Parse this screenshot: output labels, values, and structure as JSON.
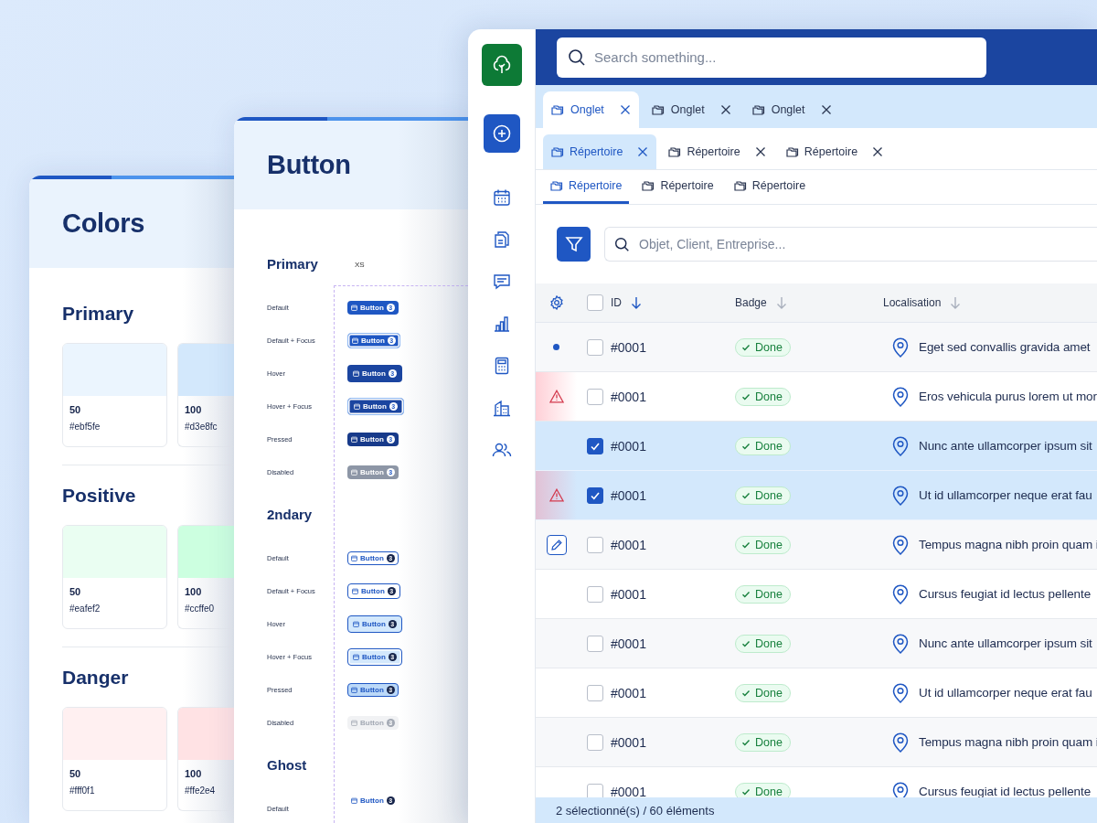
{
  "colors_panel": {
    "title": "Colors",
    "groups": [
      {
        "name": "Primary",
        "swatches": [
          {
            "shade": "50",
            "hex": "#ebf5fe",
            "color": "#ebf5fe"
          },
          {
            "shade": "100",
            "hex": "#d3e8fc",
            "color": "#d3e8fc"
          }
        ]
      },
      {
        "name": "Positive",
        "swatches": [
          {
            "shade": "50",
            "hex": "#eafef2",
            "color": "#eafef2"
          },
          {
            "shade": "100",
            "hex": "#ccffe0",
            "color": "#ccffe0"
          }
        ]
      },
      {
        "name": "Danger",
        "swatches": [
          {
            "shade": "50",
            "hex": "#fff0f1",
            "color": "#fff0f1"
          },
          {
            "shade": "100",
            "hex": "#ffe2e4",
            "color": "#ffe2e4"
          }
        ]
      }
    ]
  },
  "button_panel": {
    "title": "Button",
    "size_label": "XS",
    "sections": [
      {
        "name": "Primary",
        "kind": "primary",
        "states": [
          {
            "label": "Default",
            "kind": "rest",
            "focused": false,
            "button": "Button",
            "badge": "3"
          },
          {
            "label": "Default + Focus",
            "kind": "rest",
            "focused": true,
            "button": "Button",
            "badge": "3"
          },
          {
            "label": "Hover",
            "kind": "hover",
            "focused": false,
            "button": "Button",
            "badge": "3"
          },
          {
            "label": "Hover + Focus",
            "kind": "hover",
            "focused": true,
            "button": "Button",
            "badge": "3"
          },
          {
            "label": "Pressed",
            "kind": "pressed",
            "focused": false,
            "button": "Button",
            "badge": "3"
          },
          {
            "label": "Disabled",
            "kind": "disabled",
            "focused": false,
            "button": "Button",
            "badge": "3"
          }
        ]
      },
      {
        "name": "2ndary",
        "kind": "secondary",
        "states": [
          {
            "label": "Default",
            "kind": "rest",
            "focused": false,
            "button": "Button",
            "badge": "3"
          },
          {
            "label": "Default + Focus",
            "kind": "rest",
            "focused": true,
            "button": "Button",
            "badge": "3"
          },
          {
            "label": "Hover",
            "kind": "hover",
            "focused": false,
            "button": "Button",
            "badge": "3"
          },
          {
            "label": "Hover + Focus",
            "kind": "hover",
            "focused": true,
            "button": "Button",
            "badge": "3"
          },
          {
            "label": "Pressed",
            "kind": "pressed",
            "focused": false,
            "button": "Button",
            "badge": "3"
          },
          {
            "label": "Disabled",
            "kind": "disabled",
            "focused": false,
            "button": "Button",
            "badge": "3"
          }
        ]
      },
      {
        "name": "Ghost",
        "kind": "ghost",
        "states": [
          {
            "label": "Default",
            "kind": "rest",
            "focused": false,
            "button": "Button",
            "badge": "3"
          }
        ]
      }
    ]
  },
  "search": {
    "placeholder": "Search something..."
  },
  "tabs": [
    {
      "label": "Onglet",
      "selected": true
    },
    {
      "label": "Onglet",
      "selected": false
    },
    {
      "label": "Onglet",
      "selected": false
    }
  ],
  "folder_tabs": [
    {
      "label": "Répertoire",
      "selected": true
    },
    {
      "label": "Répertoire",
      "selected": false
    },
    {
      "label": "Répertoire",
      "selected": false
    }
  ],
  "section_tabs": [
    {
      "label": "Répertoire",
      "selected": true
    },
    {
      "label": "Répertoire",
      "selected": false
    },
    {
      "label": "Répertoire",
      "selected": false
    }
  ],
  "filter_search": {
    "placeholder": "Objet, Client, Entreprise..."
  },
  "table": {
    "all_checked": false,
    "columns": [
      {
        "label": "ID",
        "sorted": true
      },
      {
        "label": "Badge",
        "sorted": false
      },
      {
        "label": "Localisation",
        "sorted": false
      }
    ],
    "rows": [
      {
        "kind": "dot",
        "checked": false,
        "id": "#0001",
        "badge": "Done",
        "location": "Eget sed convallis gravida amet"
      },
      {
        "kind": "warning",
        "checked": false,
        "id": "#0001",
        "badge": "Done",
        "location": "Eros vehicula purus lorem ut mor"
      },
      {
        "kind": "plain",
        "checked": true,
        "id": "#0001",
        "badge": "Done",
        "location": "Nunc ante ullamcorper ipsum sit"
      },
      {
        "kind": "warning",
        "checked": true,
        "id": "#0001",
        "badge": "Done",
        "location": "Ut id ullamcorper neque erat fau"
      },
      {
        "kind": "edit",
        "checked": false,
        "id": "#0001",
        "badge": "Done",
        "location": "Tempus magna nibh proin quam i"
      },
      {
        "kind": "plain",
        "checked": false,
        "id": "#0001",
        "badge": "Done",
        "location": "Cursus feugiat id lectus pellente"
      },
      {
        "kind": "plain",
        "checked": false,
        "id": "#0001",
        "badge": "Done",
        "location": "Nunc ante ullamcorper ipsum sit"
      },
      {
        "kind": "plain",
        "checked": false,
        "id": "#0001",
        "badge": "Done",
        "location": "Ut id ullamcorper neque erat fau"
      },
      {
        "kind": "plain",
        "checked": false,
        "id": "#0001",
        "badge": "Done",
        "location": "Tempus magna nibh proin quam i"
      },
      {
        "kind": "plain",
        "checked": false,
        "id": "#0001",
        "badge": "Done",
        "location": "Cursus feugiat id lectus pellente"
      }
    ]
  },
  "status_bar": "2 sélectionné(s) / 60 éléments"
}
